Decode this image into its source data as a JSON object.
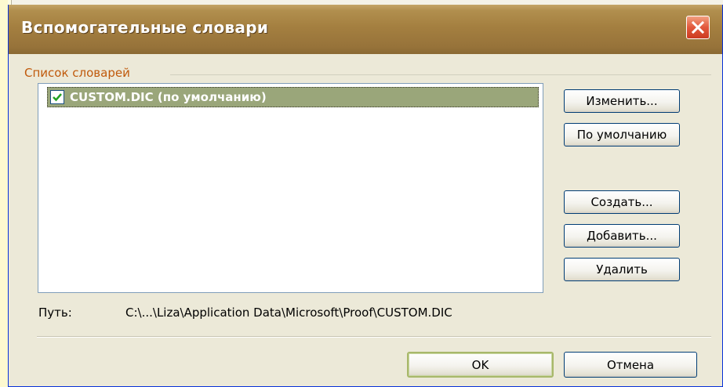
{
  "window": {
    "title": "Вспомогательные словари",
    "close_icon": "close-icon"
  },
  "group": {
    "label": "Список словарей"
  },
  "dictionaries": [
    {
      "label": "CUSTOM.DIC (по умолчанию)",
      "checked": true,
      "selected": true
    }
  ],
  "buttons": {
    "modify": "Изменить...",
    "set_default": "По умолчанию",
    "create": "Создать...",
    "add": "Добавить...",
    "delete": "Удалить",
    "ok": "OK",
    "cancel": "Отмена"
  },
  "path": {
    "label": "Путь:",
    "value": "C:\\...\\Liza\\Application Data\\Microsoft\\Proof\\CUSTOM.DIC"
  },
  "colors": {
    "titlebar": "#a47f40",
    "selection": "#9aa67a",
    "group_label": "#c05a0c",
    "close_button": "#e2583c"
  }
}
